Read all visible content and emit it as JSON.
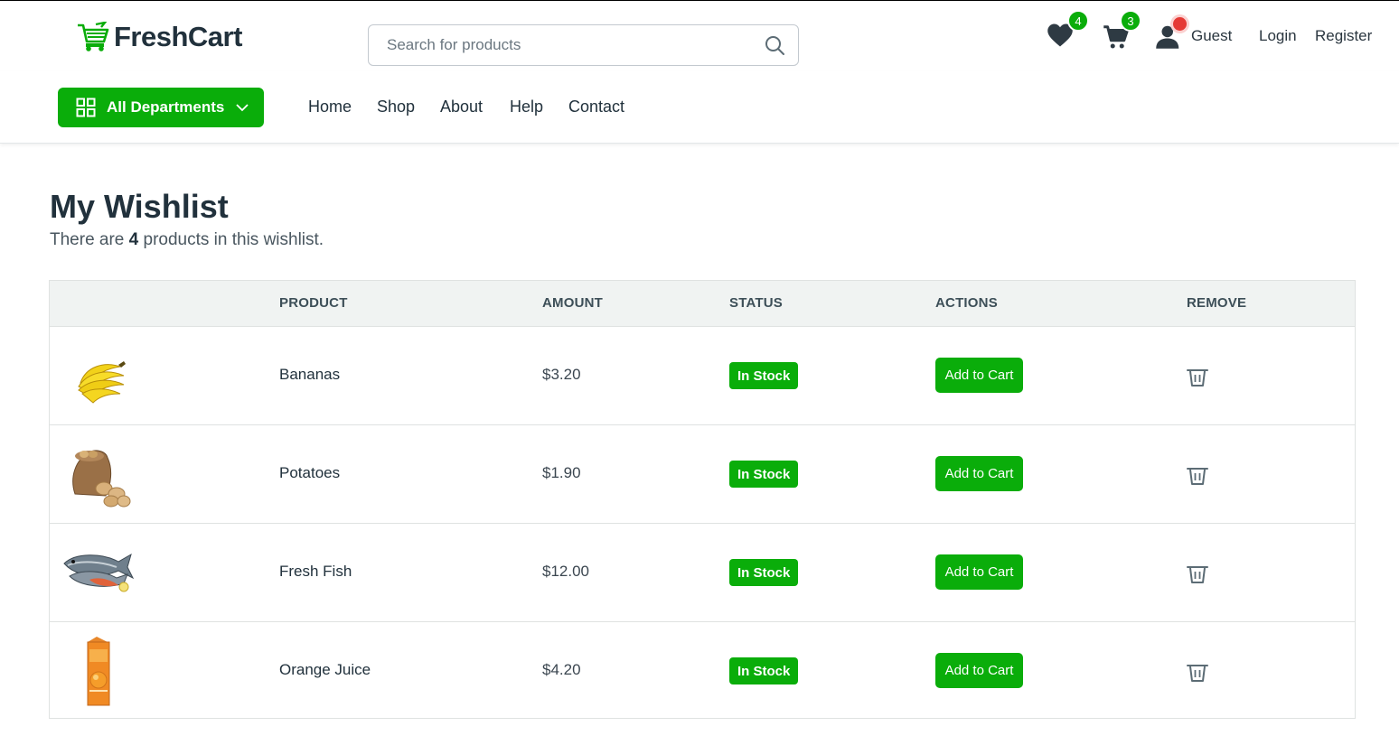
{
  "header": {
    "brand": "FreshCart",
    "search_placeholder": "Search for products",
    "wishlist_count": "4",
    "cart_count": "3",
    "user_label": "Guest",
    "login_label": "Login",
    "register_label": "Register"
  },
  "nav": {
    "departments_label": "All Departments",
    "links": [
      "Home",
      "Shop",
      "About",
      "Help",
      "Contact"
    ]
  },
  "page": {
    "title": "My Wishlist",
    "subtitle_before": "There are ",
    "subtitle_count": "4",
    "subtitle_after": " products in this wishlist."
  },
  "table": {
    "headers": [
      "PRODUCT",
      "AMOUNT",
      "STATUS",
      "ACTIONS",
      "REMOVE"
    ],
    "rows": [
      {
        "name": "Bananas",
        "amount": "$3.20",
        "status": "In Stock",
        "action": "Add to Cart",
        "image": "bananas-image"
      },
      {
        "name": "Potatoes",
        "amount": "$1.90",
        "status": "In Stock",
        "action": "Add to Cart",
        "image": "potatoes-image"
      },
      {
        "name": "Fresh Fish",
        "amount": "$12.00",
        "status": "In Stock",
        "action": "Add to Cart",
        "image": "fish-image"
      },
      {
        "name": "Orange Juice",
        "amount": "$4.20",
        "status": "In Stock",
        "action": "Add to Cart",
        "image": "orange-juice-image"
      }
    ]
  },
  "colors": {
    "brand_green": "#0aad0a",
    "text_dark": "#21313c",
    "header_bg": "#f0f3f2",
    "user_dot": "#e53935"
  },
  "icons": [
    "cart-logo-icon",
    "search-icon",
    "heart-icon",
    "cart-icon",
    "user-icon",
    "grid-icon",
    "chevron-down-icon",
    "trash-icon"
  ]
}
